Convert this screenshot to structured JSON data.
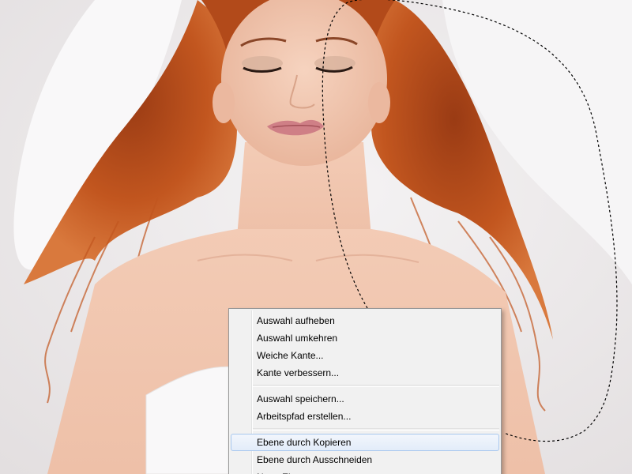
{
  "image": {
    "subject": "woman with long curly red hair, eyes closed, white strapless top, lying on white fabric",
    "colors": {
      "background": "#ece9ea",
      "hair": "#b94f1c",
      "skin": "#f0c5ae",
      "fabric": "#f8f7f8",
      "selection_marquee": "#000000"
    }
  },
  "context_menu": {
    "items": [
      {
        "id": "deselect",
        "label": "Auswahl aufheben"
      },
      {
        "id": "invert",
        "label": "Auswahl umkehren"
      },
      {
        "id": "feather",
        "label": "Weiche Kante..."
      },
      {
        "id": "refine-edge",
        "label": "Kante verbessern..."
      },
      {
        "separator": true
      },
      {
        "id": "save-selection",
        "label": "Auswahl speichern..."
      },
      {
        "id": "make-work-path",
        "label": "Arbeitspfad erstellen..."
      },
      {
        "separator": true
      },
      {
        "id": "layer-via-copy",
        "label": "Ebene durch Kopieren",
        "highlighted": true
      },
      {
        "id": "layer-via-cut",
        "label": "Ebene durch Ausschneiden"
      },
      {
        "id": "new-layer",
        "label": "Neue Ebene..."
      }
    ]
  }
}
